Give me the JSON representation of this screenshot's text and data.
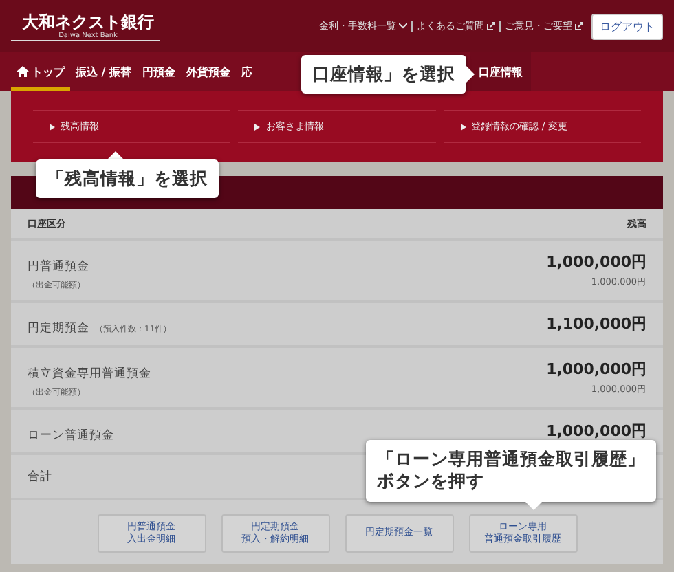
{
  "header": {
    "logo": "大和ネクスト銀行",
    "logo_sub": "Daiwa Next Bank",
    "links": [
      {
        "label": "金利・手数料一覧",
        "kind": "dropdown"
      },
      {
        "label": "よくあるご質問",
        "kind": "external"
      },
      {
        "label": "ご意見・ご要望",
        "kind": "external"
      }
    ],
    "logout": "ログアウト"
  },
  "nav": [
    {
      "label": "トップ",
      "selected": true
    },
    {
      "label": "振込 / 振替",
      "selected": false
    },
    {
      "label": "円預金",
      "selected": false
    },
    {
      "label": "外貨預金",
      "selected": false
    },
    {
      "label": "応",
      "selected": false
    },
    {
      "label": "口座情報",
      "selected": false
    }
  ],
  "submenu": [
    {
      "label": "残高情報"
    },
    {
      "label": "お客さま情報"
    },
    {
      "label": "登録情報の確認 / 変更"
    }
  ],
  "table": {
    "columns": [
      "口座区分",
      "残高"
    ],
    "rows": [
      {
        "name": "円普通預金",
        "note": "",
        "sub": "（出金可能額）",
        "amount": "1,000,000円",
        "sub_amount": "1,000,000円"
      },
      {
        "name": "円定期預金",
        "note": "（預入件数：11件）",
        "sub": "",
        "amount": "1,100,000円",
        "sub_amount": ""
      },
      {
        "name": "積立資金専用普通預金",
        "note": "",
        "sub": "（出金可能額）",
        "amount": "1,000,000円",
        "sub_amount": "1,000,000円"
      },
      {
        "name": "ローン普通預金",
        "note": "",
        "sub": "",
        "amount": "1,000,000円",
        "sub_amount": ""
      }
    ],
    "total": "合計"
  },
  "buttons": [
    [
      "円普通預金",
      "入出金明細"
    ],
    [
      "円定期預金",
      "預入・解約明細"
    ],
    [
      "円定期預金一覧"
    ],
    [
      "ローン専用",
      "普通預金取引履歴"
    ]
  ],
  "callouts": [
    [
      "口座情報」を選択"
    ],
    [
      "「残高情報」を選択"
    ],
    [
      "「ローン専用普通預金取引履歴」",
      "ボタンを押す"
    ]
  ]
}
